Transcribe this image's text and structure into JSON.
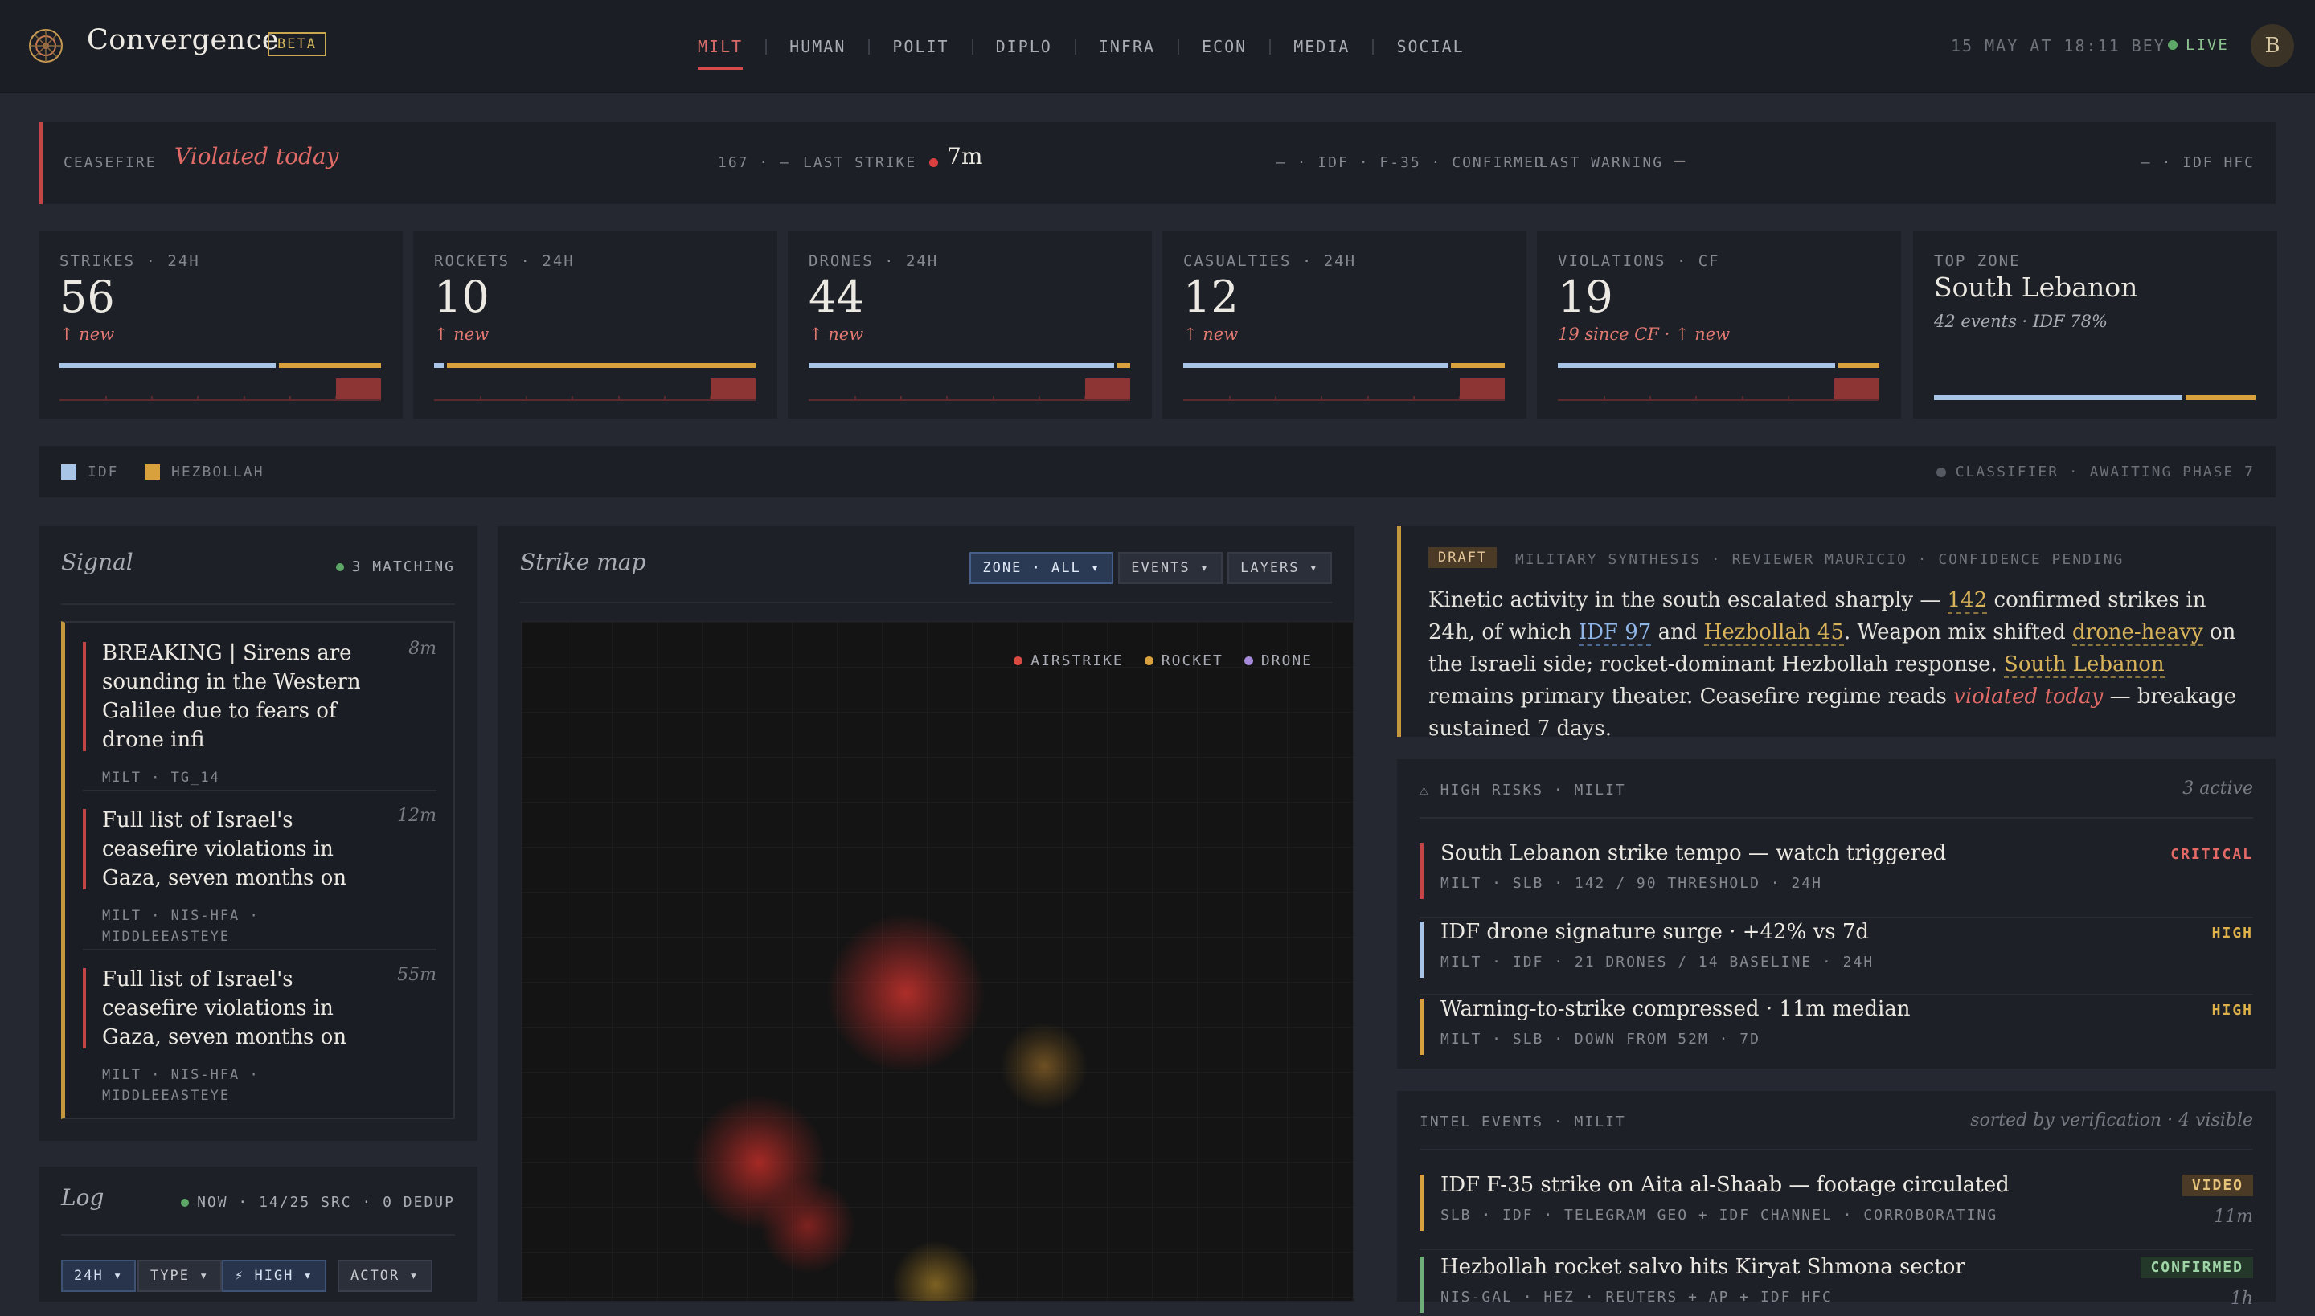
{
  "header": {
    "app_title": "Convergence",
    "beta": "BETA",
    "nav": [
      "MILT",
      "HUMAN",
      "POLIT",
      "DIPLO",
      "INFRA",
      "ECON",
      "MEDIA",
      "SOCIAL"
    ],
    "active_nav": "MILT",
    "datetime": "15 MAY AT 18:11 BEY",
    "live": "LIVE",
    "avatar_initial": "B"
  },
  "ceasefire": {
    "label": "CEASEFIRE",
    "status": "Violated today",
    "count_text": "167 · —",
    "last_strike_label": "LAST STRIKE",
    "last_strike_value": "7m",
    "strike_source": "— · IDF · F-35 · CONFIRMED",
    "last_warning_label": "LAST WARNING",
    "last_warning_value": "—",
    "warning_source": "— · IDF HFC"
  },
  "metrics": [
    {
      "title": "STRIKES · 24H",
      "value": "56",
      "note": "↑ new",
      "idf_share": 0.68
    },
    {
      "title": "ROCKETS · 24H",
      "value": "10",
      "note": "↑ new",
      "idf_share": 0.03
    },
    {
      "title": "DRONES · 24H",
      "value": "44",
      "note": "↑ new",
      "idf_share": 0.96
    },
    {
      "title": "CASUALTIES · 24H",
      "value": "12",
      "note": "↑ new",
      "idf_share": 0.83
    },
    {
      "title": "VIOLATIONS · CF",
      "value": "19",
      "note": "19 since CF · ↑ new",
      "idf_share": 0.87
    }
  ],
  "top_zone": {
    "title": "TOP ZONE",
    "zone": "South Lebanon",
    "note": "42 events · IDF 78%",
    "idf_share": 0.78
  },
  "legend": {
    "idf": "IDF",
    "hezbollah": "HEZBOLLAH",
    "classifier": "CLASSIFIER · AWAITING PHASE 7"
  },
  "colors": {
    "idf": "#a8c4e6",
    "hezbollah": "#d9a13d",
    "alert": "#c44545",
    "live": "#5da866"
  },
  "signal": {
    "title": "Signal",
    "count": "3 MATCHING",
    "items": [
      {
        "title": "BREAKING | Sirens are sounding in the Western Galilee due to fears of drone infi",
        "time": "8m",
        "meta": "MILT · TG_14"
      },
      {
        "title": "Full list of Israel's ceasefire violations in Gaza, seven months on",
        "time": "12m",
        "meta": "MILT · NIS-HFA · MIDDLEEASTEYE"
      },
      {
        "title": "Full list of Israel's ceasefire violations in Gaza, seven months on",
        "time": "55m",
        "meta": "MILT · NIS-HFA · MIDDLEEASTEYE"
      }
    ]
  },
  "log": {
    "title": "Log",
    "meta": "NOW · 14/25 SRC · 0 DEDUP",
    "chips": [
      "24H ▾",
      "TYPE ▾",
      "⚡ HIGH ▾",
      "ACTOR ▾"
    ]
  },
  "strike_map": {
    "title": "Strike map",
    "controls": [
      "ZONE · ALL ▾",
      "EVENTS ▾",
      "LAYERS ▾"
    ],
    "legend": [
      "AIRSTRIKE",
      "ROCKET",
      "DRONE"
    ]
  },
  "synthesis": {
    "badge": "DRAFT",
    "meta": "MILITARY SYNTHESIS · REVIEWER MAURICIO · CONFIDENCE PENDING",
    "t1": "Kinetic activity in the south escalated sharply — ",
    "h1": "142",
    "t2": " confirmed strikes in 24h, of which ",
    "h2": "IDF 97",
    "t3": " and ",
    "h3": "Hezbollah 45",
    "t4": ". Weapon mix shifted ",
    "h4": "drone-heavy",
    "t5": " on the Israeli side; rocket-dominant Hezbollah response. ",
    "h5": "South Lebanon",
    "t6": " remains primary theater. Ceasefire regime reads ",
    "h6": "violated today",
    "t7": " — breakage sustained 7 days."
  },
  "high_risks": {
    "title": "⚠ HIGH RISKS · MILIT",
    "active": "3 active",
    "items": [
      {
        "title": "South Lebanon strike tempo — watch triggered",
        "meta": "MILT · SLB · 142 / 90 THRESHOLD · 24H",
        "level": "CRITICAL"
      },
      {
        "title": "IDF drone signature surge · +42% vs 7d",
        "meta": "MILT · IDF · 21 DRONES / 14 BASELINE · 24H",
        "level": "HIGH"
      },
      {
        "title": "Warning-to-strike compressed · 11m median",
        "meta": "MILT · SLB · DOWN FROM 52M · 7D",
        "level": "HIGH"
      }
    ]
  },
  "intel": {
    "title": "INTEL EVENTS · MILIT",
    "sort": "sorted by verification · 4 visible",
    "items": [
      {
        "title": "IDF F-35 strike on Aita al-Shaab — footage circulated",
        "meta": "SLB · IDF · TELEGRAM GEO + IDF CHANNEL · CORROBORATING",
        "badge": "VIDEO",
        "time": "11m"
      },
      {
        "title": "Hezbollah rocket salvo hits Kiryat Shmona sector",
        "meta": "NIS-GAL · HEZ · REUTERS + AP + IDF HFC",
        "badge": "CONFIRMED",
        "time": "1h"
      }
    ]
  }
}
